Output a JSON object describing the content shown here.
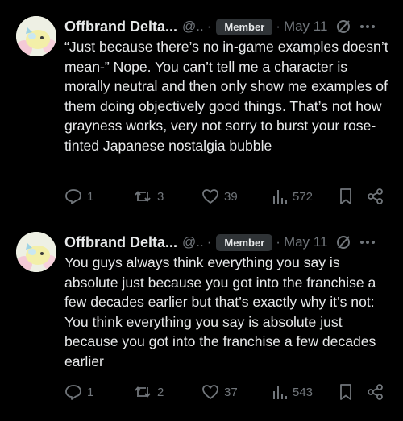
{
  "posts": [
    {
      "author_name": "Offbrand Delta...",
      "handle": "@..",
      "separator": "·",
      "badge": "Member",
      "date": "May 11",
      "text": "“Just because there’s no in-game examples doesn’t mean-” Nope. You can’t tell me a character is morally neutral and then only show me examples of them doing objectively good things. That’s not how grayness works, very not sorry to burst your rose-tinted Japanese nostalgia bubble",
      "replies": "1",
      "reposts": "3",
      "likes": "39",
      "views": "572"
    },
    {
      "author_name": "Offbrand Delta...",
      "handle": "@..",
      "separator": "·",
      "badge": "Member",
      "date": "May 11",
      "text": "You guys always think everything you say is absolute just because you got into the franchise a few decades earlier but that’s exactly why it’s not: You think everything you say is absolute just because you got into the franchise a few decades earlier",
      "replies": "1",
      "reposts": "2",
      "likes": "37",
      "views": "543"
    }
  ],
  "colors": {
    "background": "#000000",
    "text_primary": "#e7e9ea",
    "text_secondary": "#71767b",
    "badge_bg": "#2f3336"
  },
  "icons": [
    "grok-icon",
    "more-icon",
    "reply-icon",
    "repost-icon",
    "like-icon",
    "views-icon",
    "bookmark-icon",
    "share-icon"
  ]
}
